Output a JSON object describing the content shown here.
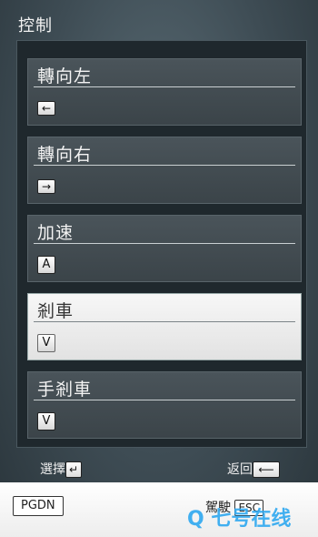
{
  "title": "控制",
  "controls": [
    {
      "label": "轉向左",
      "key": "←"
    },
    {
      "label": "轉向右",
      "key": "→"
    },
    {
      "label": "加速",
      "key": "A"
    },
    {
      "label": "剎車",
      "key": "V"
    },
    {
      "label": "手剎車",
      "key": "V"
    }
  ],
  "hints": {
    "select_label": "選擇",
    "select_key": "↵",
    "back_label": "返回",
    "back_key": "⟵"
  },
  "bottom": {
    "pgdn_label": "PGDN",
    "drive_label": "駕駛",
    "drive_key": "ESC"
  },
  "watermark": "Q 七号在线",
  "colors": {
    "selected_card": "#f0f0f0",
    "card": "#434c52",
    "watermark": "#2ea8f0"
  }
}
